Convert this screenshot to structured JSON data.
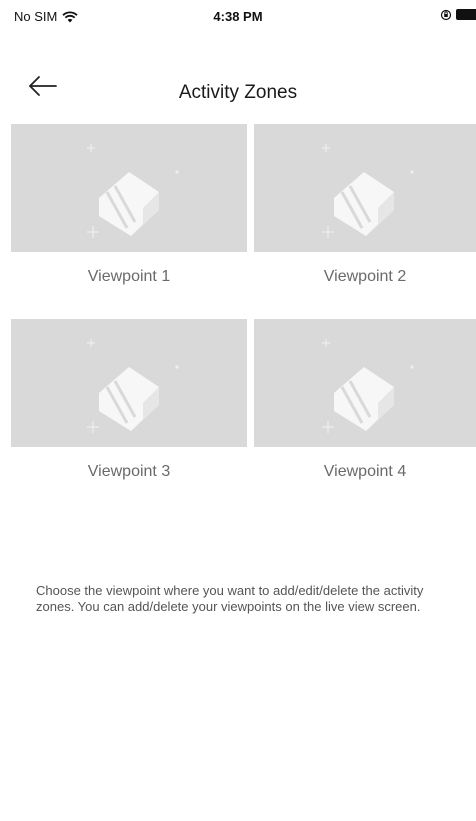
{
  "status_bar": {
    "carrier": "No SIM",
    "time": "4:38 PM"
  },
  "header": {
    "title": "Activity Zones"
  },
  "viewpoints": [
    {
      "label": "Viewpoint 1"
    },
    {
      "label": "Viewpoint 2"
    },
    {
      "label": "Viewpoint 3"
    },
    {
      "label": "Viewpoint 4"
    }
  ],
  "description": "Choose the viewpoint where you want to add/edit/delete the activity zones. You can add/delete your viewpoints on the live view screen.",
  "icons": {
    "back": "back-arrow-icon",
    "wifi": "wifi-icon",
    "orientation_lock": "orientation-lock-icon",
    "battery": "battery-icon",
    "camera_placeholder": "camera-placeholder-icon"
  },
  "colors": {
    "thumbnail_bg": "#d9d9d9",
    "label_text": "#6a6a6a",
    "description_text": "#555555"
  }
}
